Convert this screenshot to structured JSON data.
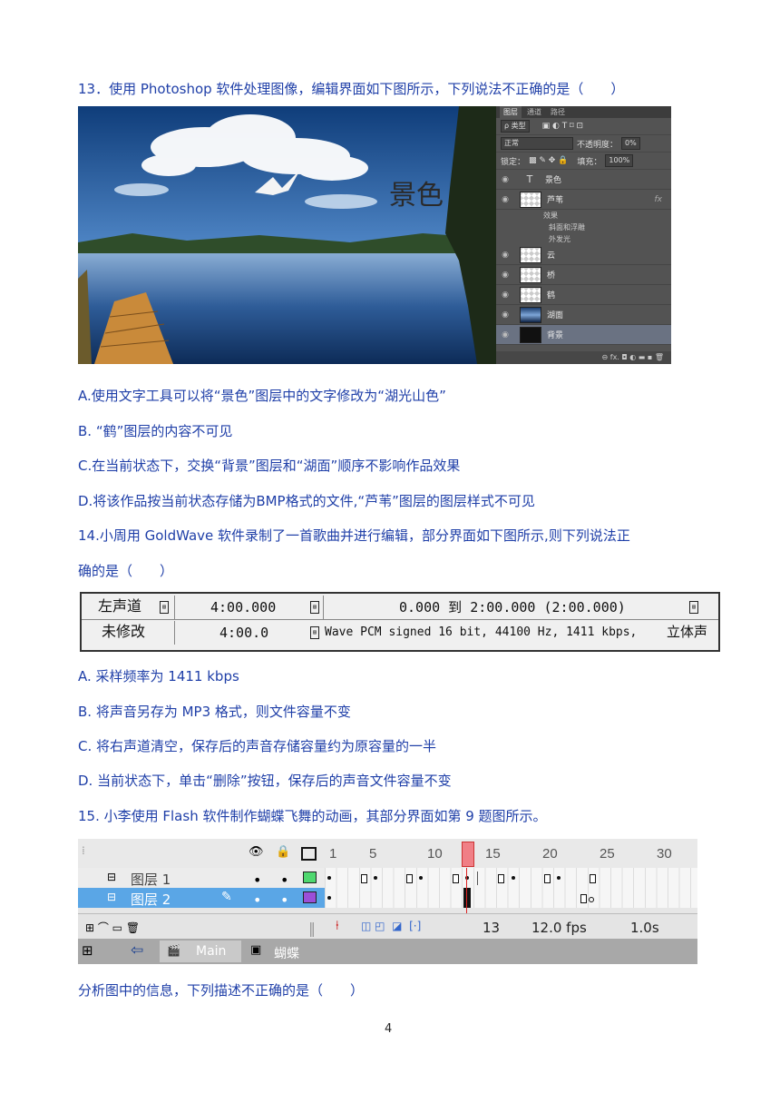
{
  "q13": {
    "stem": "13．使用 Photoshop 软件处理图像，编辑界面如下图所示，下列说法不正确的是（　　）",
    "image_text": "景色",
    "panel": {
      "tabs": [
        "图层",
        "通道",
        "路径"
      ],
      "kind_label": "ρ 类型",
      "blend_mode": "正常",
      "opacity_label": "不透明度：",
      "opacity_value": "0%",
      "lock_label": "锁定：",
      "fill_label": "填充：",
      "fill_value": "100%",
      "layers": [
        "景色",
        "芦苇",
        "云",
        "桥",
        "鹤",
        "湖面",
        "背景"
      ],
      "effects_label": "效果",
      "effect_items": [
        "斜面和浮雕",
        "外发光"
      ],
      "fx": "fx"
    },
    "options": [
      "A.使用文字工具可以将“景色”图层中的文字修改为“湖光山色”",
      "B. “鹤”图层的内容不可见",
      "C.在当前状态下，交换“背景”图层和“湖面”顺序不影响作品效果",
      "D.将该作品按当前状态存储为BMP格式的文件,“芦苇”图层的图层样式不可见"
    ]
  },
  "q14": {
    "stem_line1": "14.小周用 GoldWave 软件录制了一首歌曲并进行编辑，部分界面如下图所示,则下列说法正",
    "stem_line2": "确的是（　　）",
    "status": {
      "channel": "左声道",
      "length": "4:00.000",
      "selection": "0.000 到 2:00.000 (2:00.000)",
      "modified": "未修改",
      "length2": "4:00.0",
      "format": "Wave PCM signed 16 bit, 44100 Hz, 1411 kbps,",
      "stereo": "立体声"
    },
    "options": [
      "A. 采样频率为 1411 kbps",
      "B. 将声音另存为 MP3 格式，则文件容量不变",
      "C. 将右声道清空，保存后的声音存储容量约为原容量的一半",
      "D. 当前状态下，单击“删除”按钮，保存后的声音文件容量不变"
    ]
  },
  "q15": {
    "stem": "15. 小李使用 Flash 软件制作蝴蝶飞舞的动画，其部分界面如第 9 题图所示。",
    "timeline": {
      "frame_numbers": [
        "1",
        "5",
        "10",
        "15",
        "20",
        "25",
        "30"
      ],
      "layers": [
        "图层 1",
        "图层 2"
      ],
      "current_frame": "13",
      "fps": "12.0 fps",
      "time": "1.0s",
      "scene": "Main",
      "symbol": "蝴蝶"
    },
    "after": "分析图中的信息，下列描述不正确的是（　　）"
  },
  "page_number": "4"
}
